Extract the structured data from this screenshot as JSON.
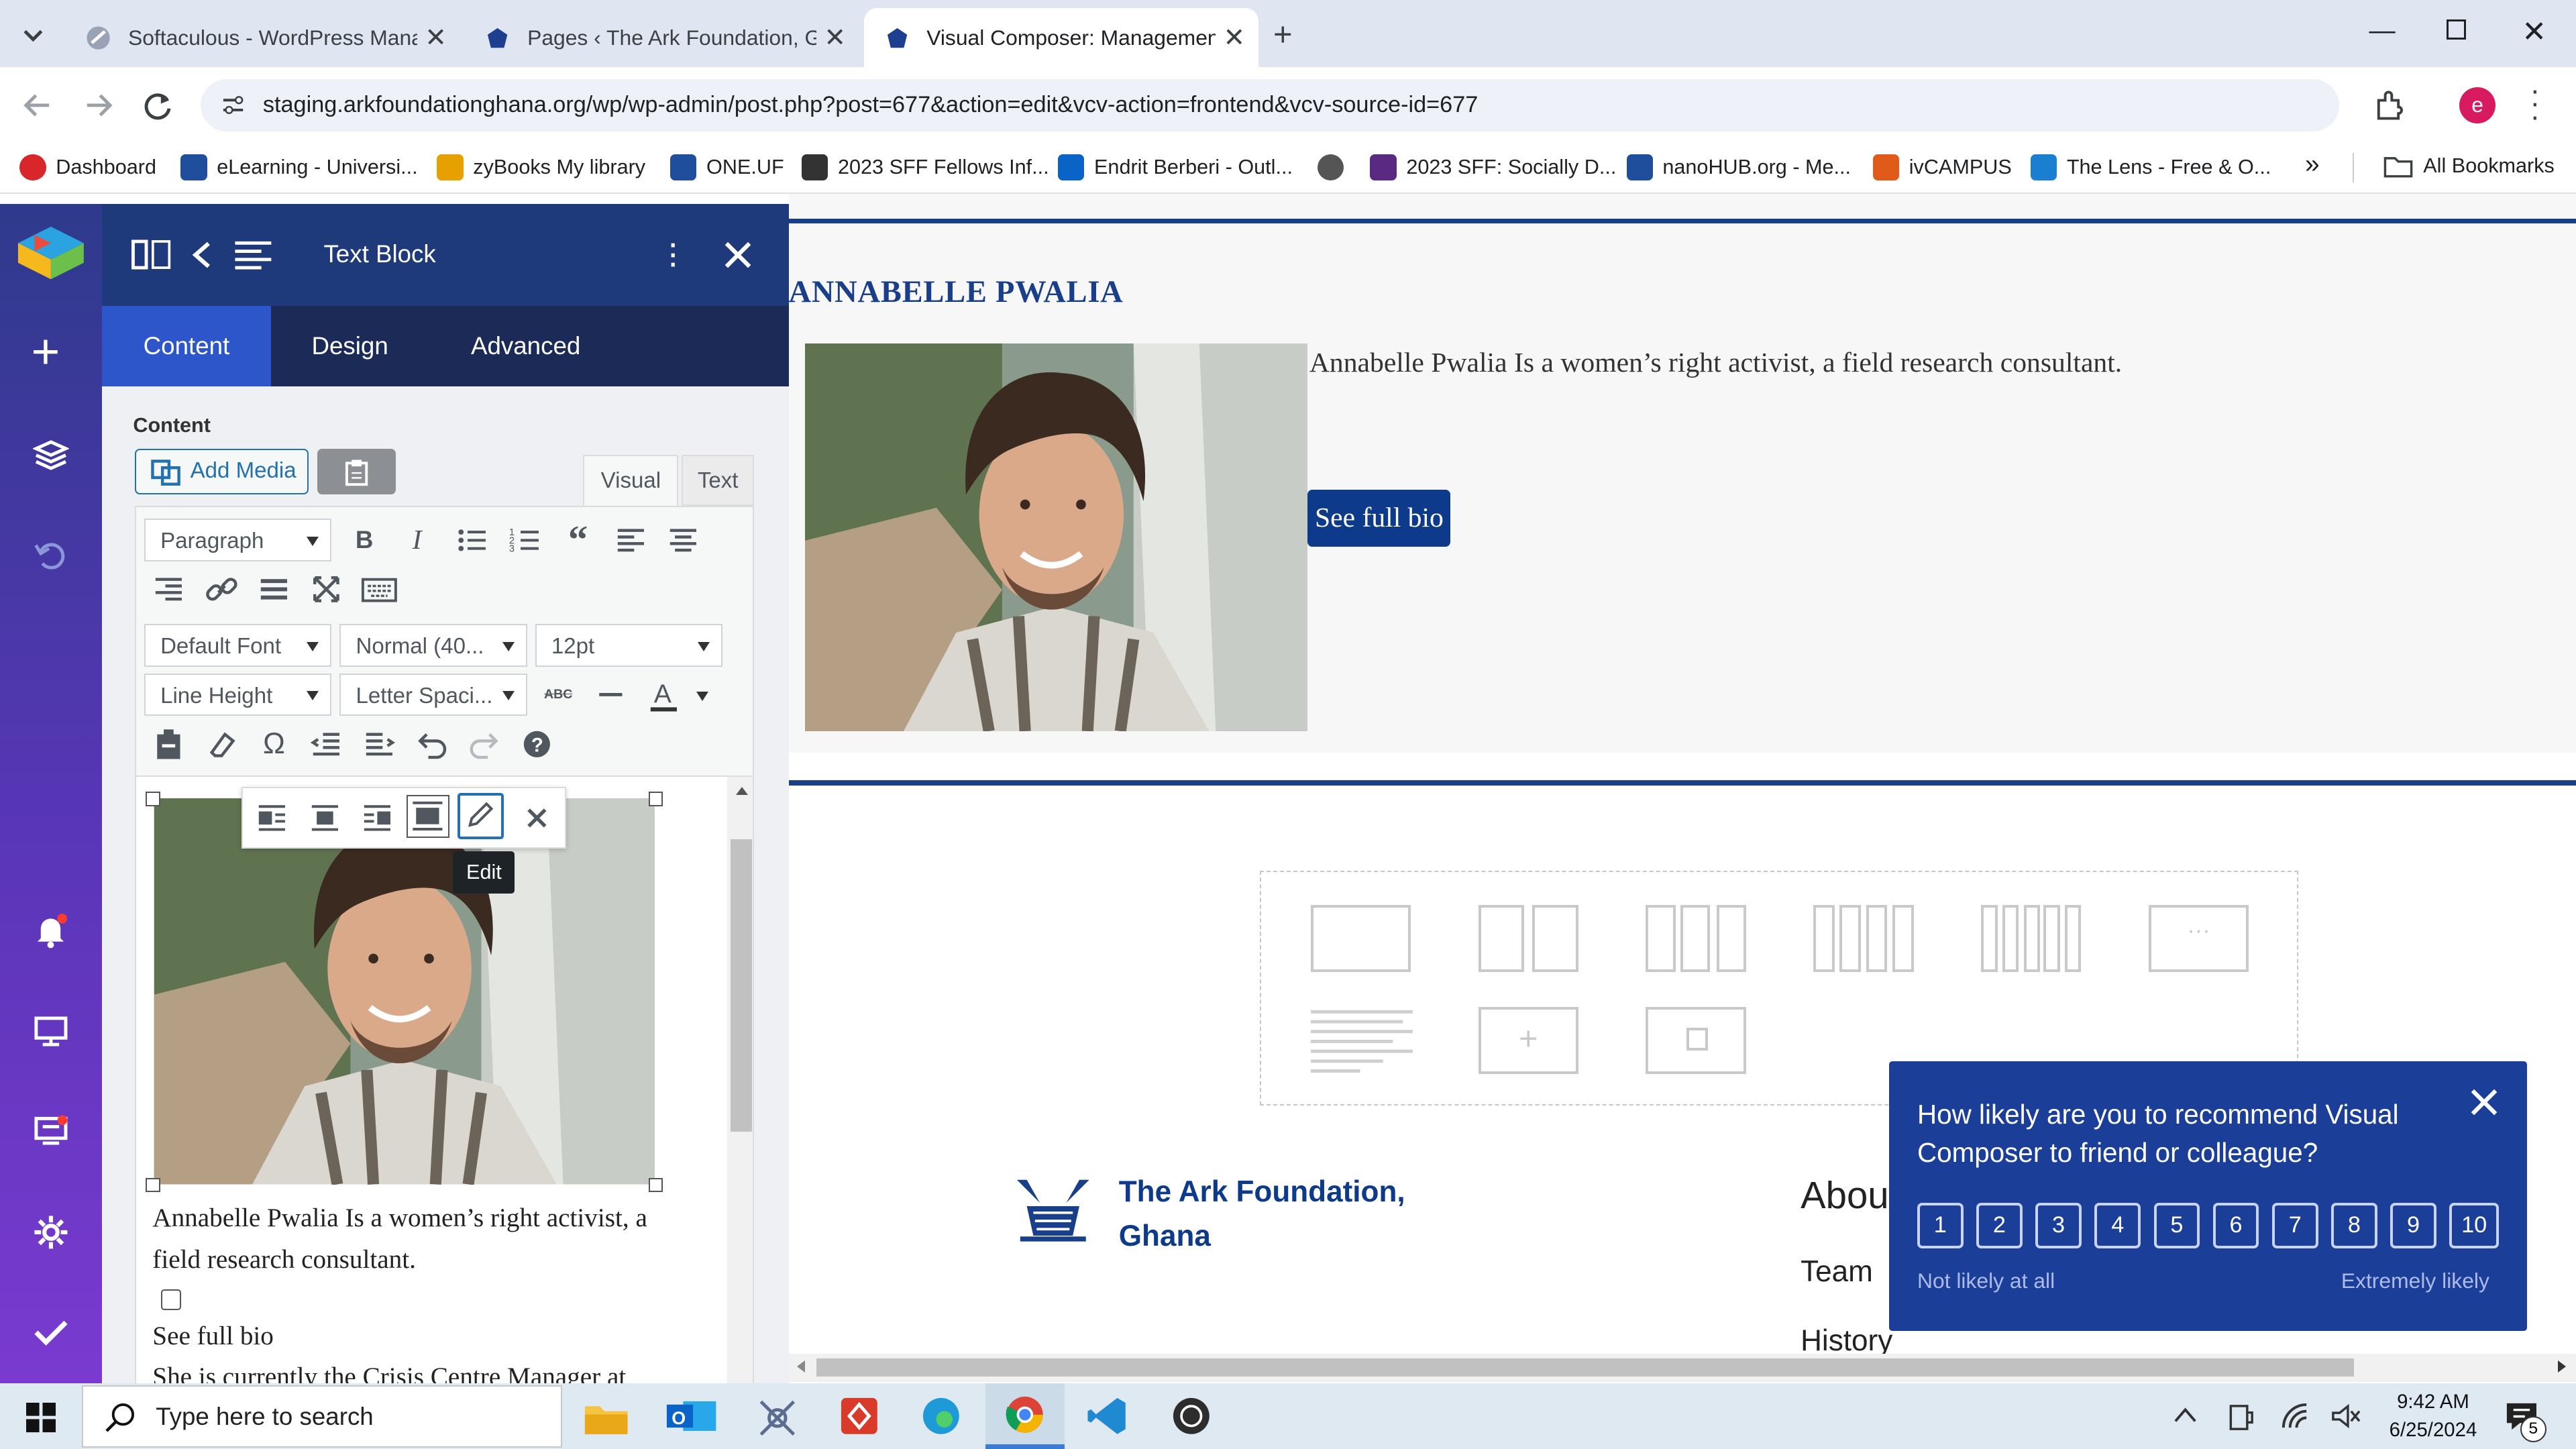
{
  "browser": {
    "tabs": [
      {
        "title": "Softaculous - WordPress Manag",
        "icon": "softaculous-icon"
      },
      {
        "title": "Pages ‹ The Ark Foundation, Gh",
        "icon": "wordpress-ark-icon"
      },
      {
        "title": "Visual Composer: Management",
        "icon": "visual-composer-tab-icon"
      }
    ],
    "url": "staging.arkfoundationghana.org/wp/wp-admin/post.php?post=677&action=edit&vcv-action=frontend&vcv-source-id=677",
    "profile_initial": "e",
    "bookmarks": [
      {
        "label": "Dashboard",
        "color": "#d9262b"
      },
      {
        "label": "eLearning - Universi...",
        "color": "#1f4e9c"
      },
      {
        "label": "zyBooks My library",
        "color": "#e6a100"
      },
      {
        "label": "ONE.UF",
        "color": "#1f4e9c"
      },
      {
        "label": "2023 SFF Fellows Inf...",
        "color": "#333333"
      },
      {
        "label": "Endrit Berberi - Outl...",
        "color": "#0a64c8"
      },
      {
        "label": "",
        "color": "#555555"
      },
      {
        "label": "2023 SFF: Socially D...",
        "color": "#5a2a82"
      },
      {
        "label": "nanoHUB.org - Me...",
        "color": "#1f4e9c"
      },
      {
        "label": "ivCAMPUS",
        "color": "#e05a1a"
      },
      {
        "label": "The Lens - Free & O...",
        "color": "#1a7fd1"
      }
    ],
    "all_bookmarks": "All Bookmarks"
  },
  "editor": {
    "panel_title": "Text Block",
    "tabs": [
      "Content",
      "Design",
      "Advanced"
    ],
    "content_label": "Content",
    "add_media": "Add Media",
    "mode_tabs": [
      "Visual",
      "Text"
    ],
    "format_select": "Paragraph",
    "font_select": "Default Font",
    "weight_select": "Normal (40...",
    "size_select": "12pt",
    "line_height_select": "Line Height",
    "letter_spacing_select": "Letter Spaci...",
    "tooltip_edit": "Edit",
    "body_text": "Annabelle Pwalia Is a women’s right activist, a field research consultant.",
    "see_full_bio": "See full bio",
    "cut_text": "She is currently the Crisis Centre Manager at"
  },
  "page": {
    "name_heading": "ANNABELLE PWALIA",
    "bio_text": "Annabelle Pwalia Is a women’s right activist, a field research consultant.",
    "bio_button": "See full bio",
    "footer_org": "The Ark Foundation,\nGhana",
    "footer_about": "About",
    "footer_links": [
      "Team",
      "History"
    ]
  },
  "survey": {
    "question": "How likely are you to recommend Visual Composer to friend or colleague?",
    "scale": [
      "1",
      "2",
      "3",
      "4",
      "5",
      "6",
      "7",
      "8",
      "9",
      "10"
    ],
    "low_label": "Not likely at all",
    "high_label": "Extremely likely"
  },
  "taskbar": {
    "search_placeholder": "Type here to search",
    "time": "9:42 AM",
    "date": "6/25/2024",
    "notification_count": "5"
  },
  "colors": {
    "vc_dark": "#1c2a58",
    "brand_blue": "#0d3a8a",
    "survey_blue": "#1b3f99"
  }
}
